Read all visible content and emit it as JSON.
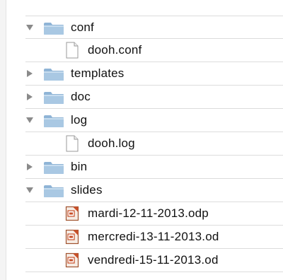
{
  "tree": {
    "items": [
      {
        "label": "conf",
        "kind": "folder",
        "expanded": true,
        "icon": "folder-icon"
      },
      {
        "label": "dooh.conf",
        "kind": "file",
        "icon": "document-icon"
      },
      {
        "label": "templates",
        "kind": "folder",
        "expanded": false,
        "icon": "folder-icon"
      },
      {
        "label": "doc",
        "kind": "folder",
        "expanded": false,
        "icon": "folder-icon"
      },
      {
        "label": "log",
        "kind": "folder",
        "expanded": true,
        "icon": "folder-icon"
      },
      {
        "label": "dooh.log",
        "kind": "file",
        "icon": "document-icon"
      },
      {
        "label": "bin",
        "kind": "folder",
        "expanded": false,
        "icon": "folder-icon"
      },
      {
        "label": "slides",
        "kind": "folder",
        "expanded": true,
        "icon": "folder-icon"
      },
      {
        "label": "mardi-12-11-2013.odp",
        "kind": "presentation",
        "icon": "presentation-icon"
      },
      {
        "label": "mercredi-13-11-2013.od",
        "kind": "presentation",
        "icon": "presentation-icon"
      },
      {
        "label": "vendredi-15-11-2013.od",
        "kind": "presentation",
        "icon": "presentation-icon"
      }
    ]
  },
  "colors": {
    "folder_body": "#a9c8e3",
    "folder_tab": "#8fb4d6",
    "disclosure": "#8a8a8a",
    "row_divider": "#dcdcdc",
    "presentation_accent": "#c8502a"
  }
}
